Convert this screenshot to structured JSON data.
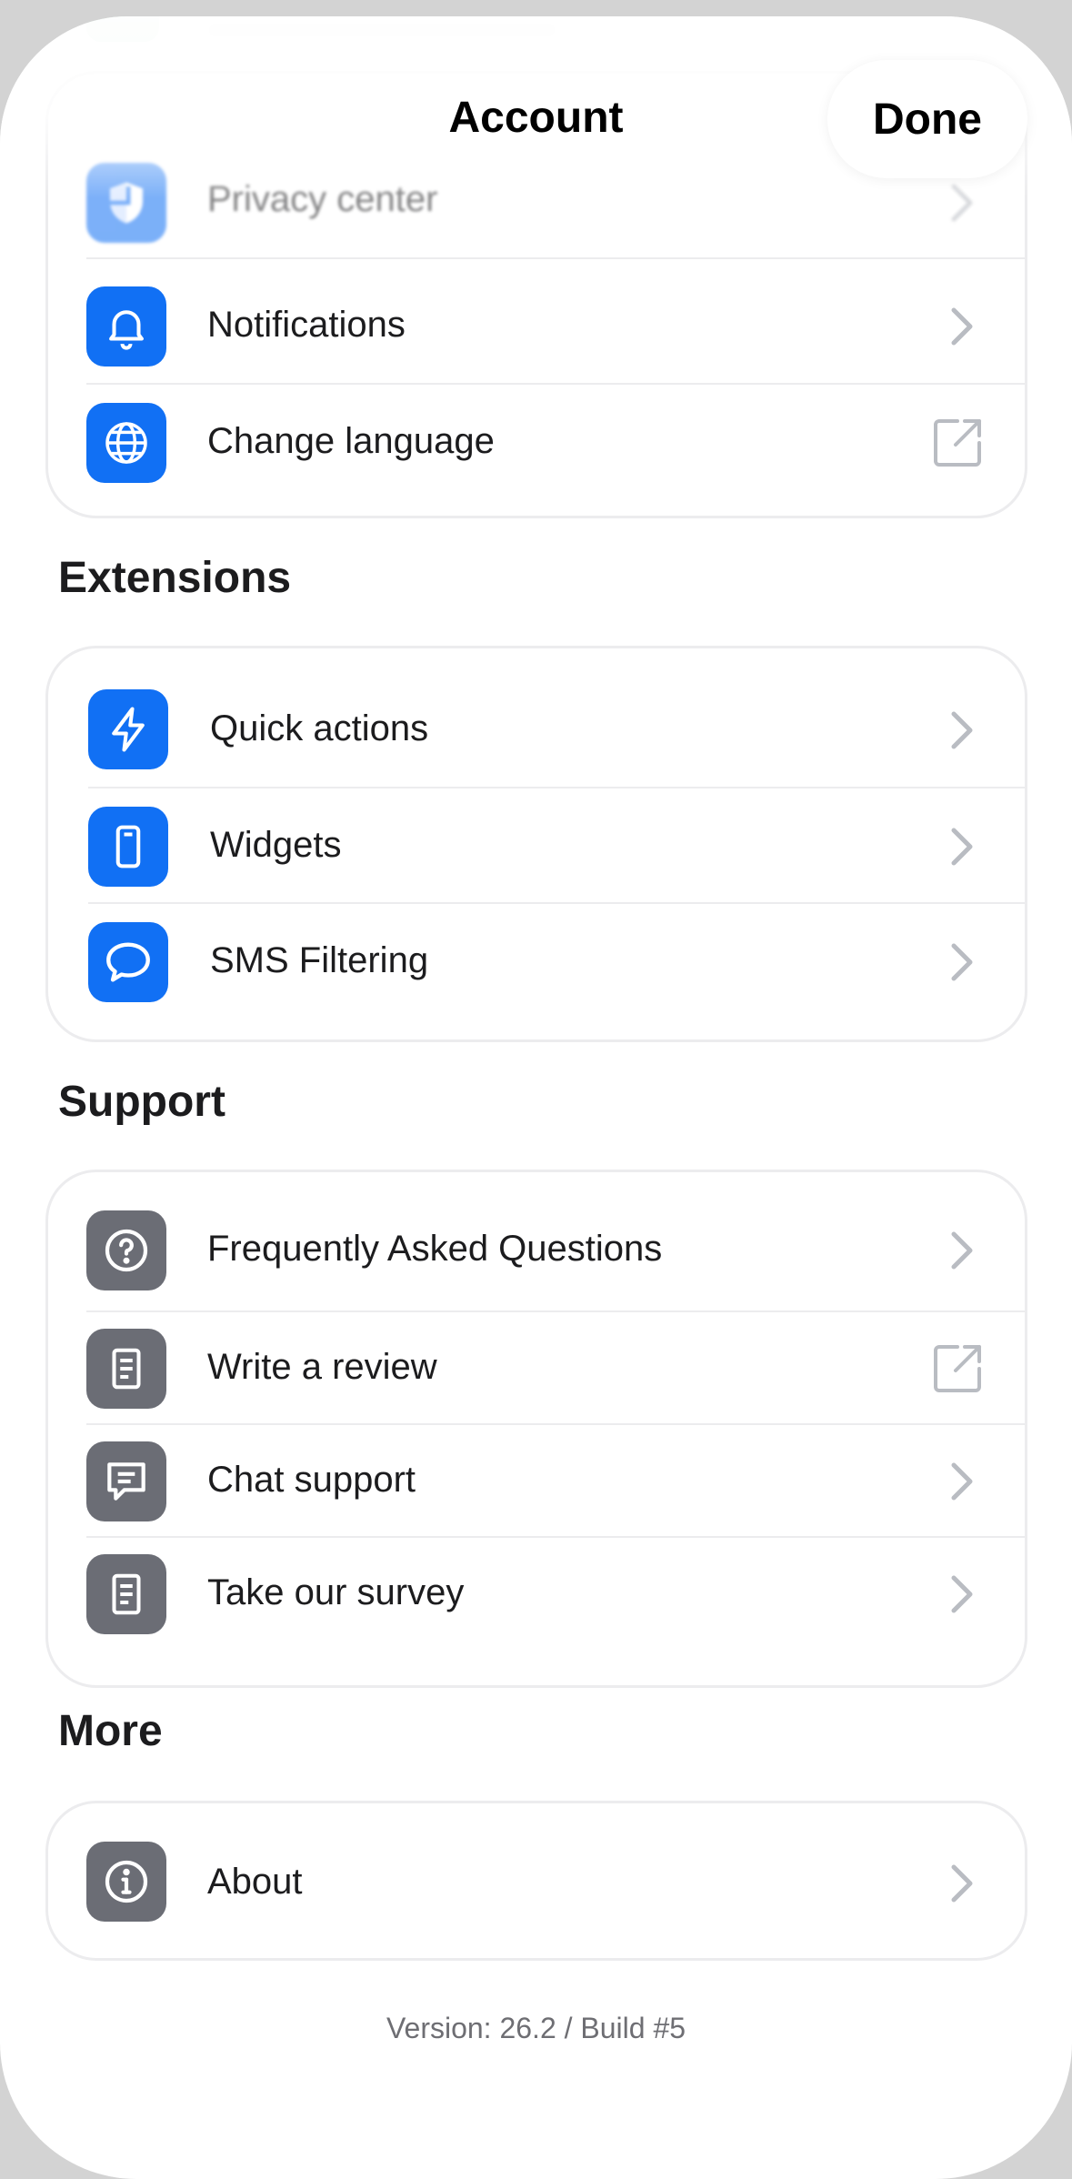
{
  "header": {
    "title": "Account",
    "done_label": "Done"
  },
  "account_items": [
    {
      "label": "Privacy center",
      "icon": "shield-icon",
      "accessory": "chevron"
    },
    {
      "label": "Notifications",
      "icon": "bell-icon",
      "accessory": "chevron"
    },
    {
      "label": "Change language",
      "icon": "globe-icon",
      "accessory": "external"
    }
  ],
  "sections": {
    "extensions": {
      "title": "Extensions",
      "items": [
        {
          "label": "Quick actions",
          "icon": "bolt-icon"
        },
        {
          "label": "Widgets",
          "icon": "widget-phone-icon"
        },
        {
          "label": "SMS Filtering",
          "icon": "message-bubble-icon"
        }
      ]
    },
    "support": {
      "title": "Support",
      "items": [
        {
          "label": "Frequently Asked Questions",
          "icon": "question-icon",
          "accessory": "chevron"
        },
        {
          "label": "Write a review",
          "icon": "document-icon",
          "accessory": "external"
        },
        {
          "label": "Chat support",
          "icon": "chat-icon",
          "accessory": "chevron"
        },
        {
          "label": "Take our survey",
          "icon": "document-icon",
          "accessory": "chevron"
        }
      ]
    },
    "more": {
      "title": "More",
      "items": [
        {
          "label": "About",
          "icon": "info-icon",
          "accessory": "chevron"
        }
      ]
    }
  },
  "footer": {
    "version": "Version: 26.2 / Build #5"
  },
  "colors": {
    "accent_blue": "#1170f4",
    "icon_gray": "#6b6d75",
    "chevron": "#b9bcc2"
  }
}
